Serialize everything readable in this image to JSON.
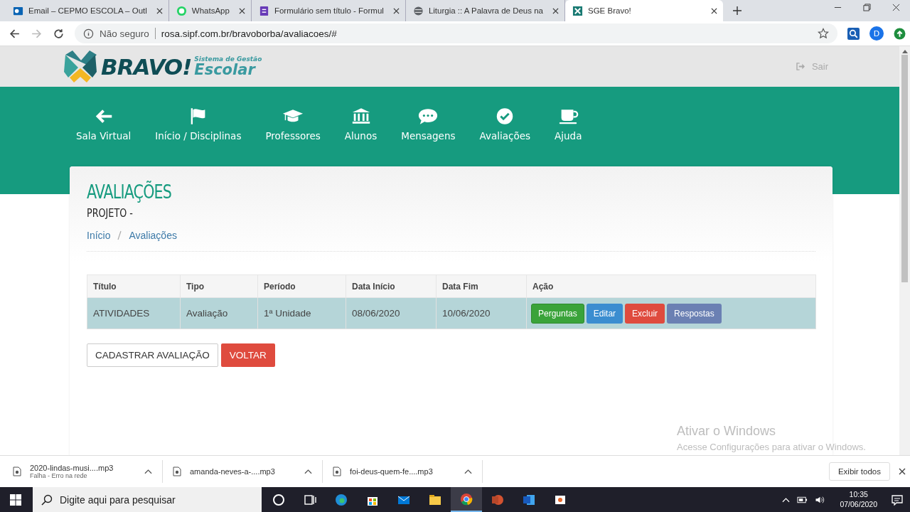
{
  "browser": {
    "tabs": [
      {
        "title": "Email – CEPMO ESCOLA – Outl",
        "selected": false
      },
      {
        "title": "WhatsApp",
        "selected": false
      },
      {
        "title": "Formulário sem título - Formul",
        "selected": false
      },
      {
        "title": "Liturgia :: A Palavra de Deus na",
        "selected": false
      },
      {
        "title": "SGE Bravo!",
        "selected": true
      }
    ],
    "security": "Não seguro",
    "url": "rosa.sipf.com.br/bravoborba/avaliacoes/#",
    "profile": "D"
  },
  "header": {
    "logo_main": "BRAVO!",
    "logo_tag": "Sistema de Gestão",
    "logo_sub": "Escolar",
    "logout": "Sair"
  },
  "nav": [
    {
      "label": "Sala Virtual"
    },
    {
      "label": "Início / Disciplinas"
    },
    {
      "label": "Professores"
    },
    {
      "label": "Alunos"
    },
    {
      "label": "Mensagens"
    },
    {
      "label": "Avaliações"
    },
    {
      "label": "Ajuda"
    }
  ],
  "page": {
    "title": "AVALIAÇÕES",
    "subtitle": "PROJETO -",
    "breadcrumb": [
      "Início",
      "Avaliações"
    ]
  },
  "table": {
    "columns": [
      "Título",
      "Tipo",
      "Período",
      "Data Início",
      "Data Fim",
      "Ação"
    ],
    "rows": [
      {
        "cells": [
          "ATIVIDADES",
          "Avaliação",
          "1ª Unidade",
          "08/06/2020",
          "10/06/2020"
        ],
        "selected": true,
        "actions": [
          {
            "label": "Perguntas",
            "kind": "success"
          },
          {
            "label": "Editar",
            "kind": "primary"
          },
          {
            "label": "Excluir",
            "kind": "danger"
          },
          {
            "label": "Respostas",
            "kind": "info"
          }
        ]
      }
    ]
  },
  "buttons": [
    {
      "label": "CADASTRAR AVALIAÇÃO",
      "kind": "default"
    },
    {
      "label": "VOLTAR",
      "kind": "danger"
    }
  ],
  "activation": {
    "title": "Ativar o Windows",
    "text": "Acesse Configurações para ativar o Windows."
  },
  "downloads": {
    "items": [
      {
        "name": "2020-lindas-musi....mp3",
        "status": "Falha - Erro na rede"
      },
      {
        "name": "amanda-neves-a-....mp3"
      },
      {
        "name": "foi-deus-quem-fe....mp3"
      }
    ],
    "show_all": "Exibir todos"
  },
  "taskbar": {
    "search": "Digite aqui para pesquisar",
    "apps": [
      {
        "kind": "cortana",
        "selected": false
      },
      {
        "kind": "taskview",
        "selected": false
      },
      {
        "kind": "edge",
        "selected": false
      },
      {
        "kind": "store",
        "selected": false
      },
      {
        "kind": "mail",
        "selected": false
      },
      {
        "kind": "explorer",
        "selected": false
      },
      {
        "kind": "chrome",
        "selected": true
      },
      {
        "kind": "powerpoint",
        "selected": false
      },
      {
        "kind": "word",
        "selected": false
      },
      {
        "kind": "presenter",
        "selected": false
      }
    ],
    "time": "10:35",
    "date": "07/06/2020"
  }
}
